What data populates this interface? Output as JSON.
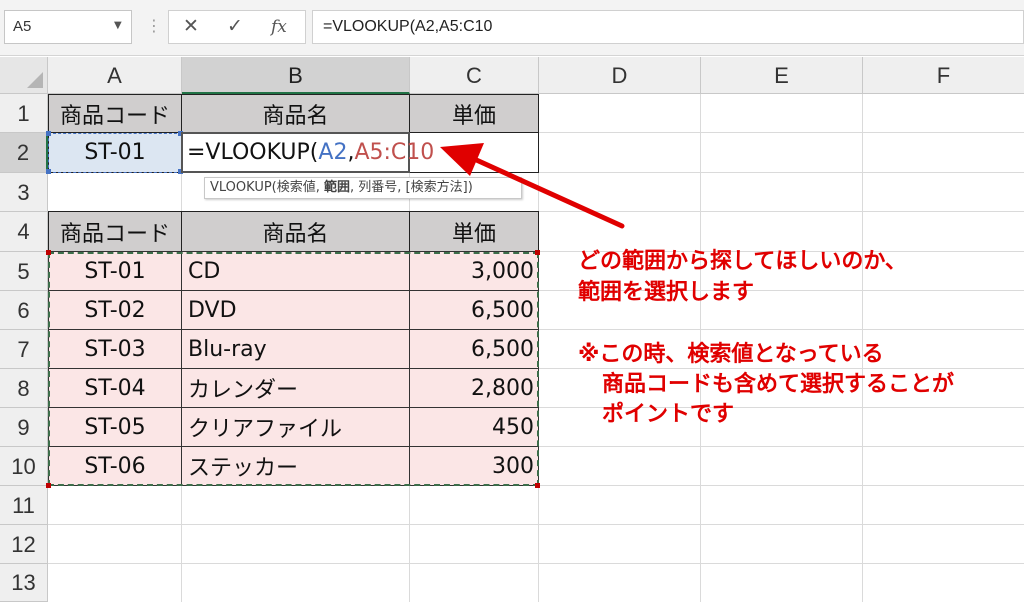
{
  "formula_bar": {
    "name_box": "A5",
    "cancel_icon": "✕",
    "enter_icon": "✓",
    "fx_icon": "fx",
    "formula": "=VLOOKUP(A2,A5:C10"
  },
  "columns": [
    "A",
    "B",
    "C",
    "D",
    "E",
    "F"
  ],
  "rows": [
    "1",
    "2",
    "3",
    "4",
    "5",
    "6",
    "7",
    "8",
    "9",
    "10",
    "11",
    "12",
    "13"
  ],
  "table_top": {
    "code_header": "商品コード",
    "name_header": "商品名",
    "price_header": "単価",
    "code_value": "ST-01"
  },
  "edit_cell": {
    "prefix": "=VLOOKUP(",
    "ref1": "A2",
    "comma": ",",
    "ref2": "A5:C10"
  },
  "tooltip": {
    "func": "VLOOKUP(検索値, ",
    "bold_arg": "範囲",
    "rest": ", 列番号, [検索方法])"
  },
  "table_main": {
    "headers": {
      "code": "商品コード",
      "name": "商品名",
      "price": "単価"
    },
    "rows": [
      {
        "code": "ST-01",
        "name": "CD",
        "price": "3,000"
      },
      {
        "code": "ST-02",
        "name": "DVD",
        "price": "6,500"
      },
      {
        "code": "ST-03",
        "name": "Blu-ray",
        "price": "6,500"
      },
      {
        "code": "ST-04",
        "name": "カレンダー",
        "price": "2,800"
      },
      {
        "code": "ST-05",
        "name": "クリアファイル",
        "price": "450"
      },
      {
        "code": "ST-06",
        "name": "ステッカー",
        "price": "300"
      }
    ]
  },
  "annotation": {
    "line1": "どの範囲から探してほしいのか、",
    "line2": "範囲を選択します",
    "note1": "※この時、検索値となっている",
    "note2": "商品コードも含めて選択することが",
    "note3": "ポイントです"
  },
  "colors": {
    "accent_green": "#217346",
    "annotation_red": "#e00000",
    "ref_blue": "#4472c4",
    "ref_red": "#c0504d"
  }
}
